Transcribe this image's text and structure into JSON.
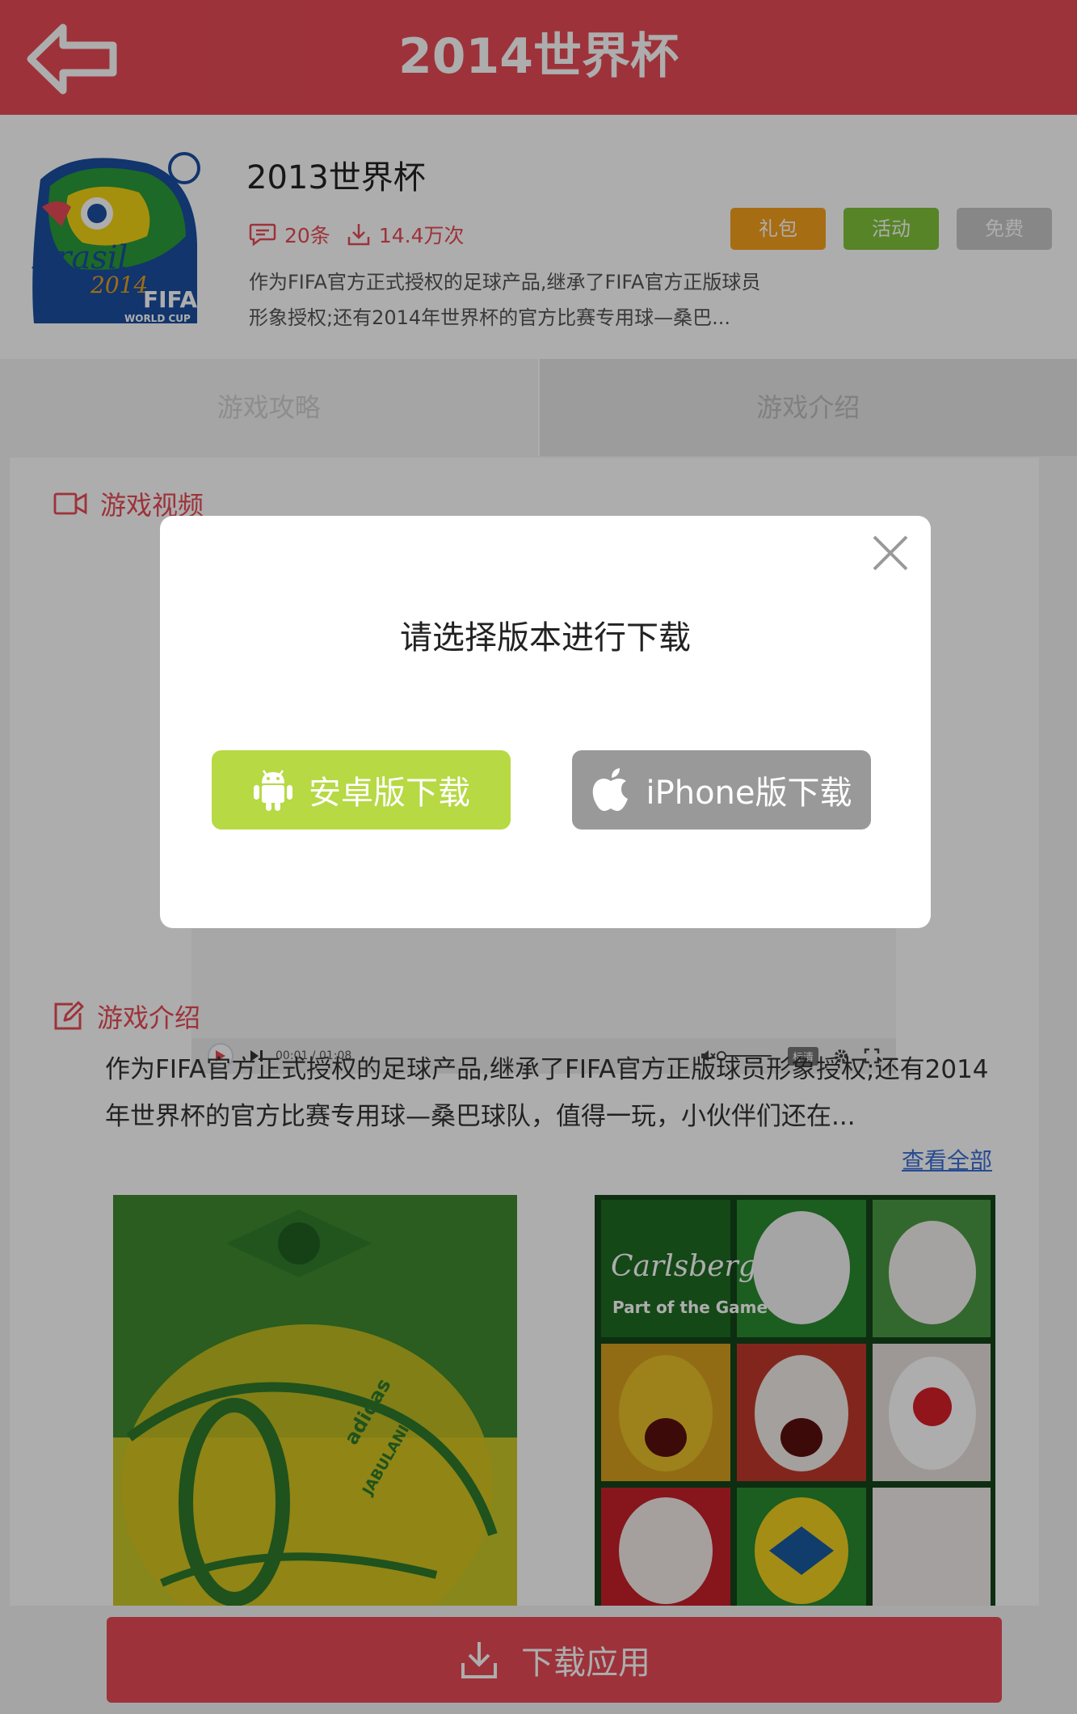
{
  "header": {
    "title": "2014世界杯"
  },
  "app": {
    "name": "2013世界杯",
    "comments": "20条",
    "downloads": "14.4万次",
    "description": "作为FIFA官方正式授权的足球产品,继承了FIFA官方正版球员形象授权;还有2014年世界杯的官方比赛专用球—桑巴...",
    "icon_text": {
      "brand": "Brasil",
      "year": "2014",
      "org": "FIFA",
      "sub": "WORLD CUP"
    },
    "tags": {
      "gift": "礼包",
      "event": "活动",
      "free": "免费"
    }
  },
  "tabs": {
    "guide": "游戏攻略",
    "intro": "游戏介绍"
  },
  "video": {
    "heading": "游戏视频",
    "time": "00:01 / 01:08",
    "quality": "标清"
  },
  "intro": {
    "heading": "游戏介绍",
    "text": "作为FIFA官方正式授权的足球产品,继承了FIFA官方正版球员形象授权;还有2014年世界杯的官方比赛专用球—桑巴球队，值得一玩，小伙伴们还在...",
    "view_all": "查看全部"
  },
  "screenshots": {
    "first": {
      "brand": "adidas",
      "name": "JABULANI"
    },
    "second": {
      "brand": "Carlsberg",
      "slogan": "Part of the Game"
    }
  },
  "footer": {
    "download_label": "下载应用"
  },
  "modal": {
    "title": "请选择版本进行下载",
    "android_label": "安卓版下载",
    "iphone_label": "iPhone版下载"
  },
  "colors": {
    "header": "#e84b56",
    "android": "#b6d944",
    "iphone": "#999999",
    "gift_tag": "#f7a11d",
    "event_tag": "#7fc33a",
    "free_tag": "#c8c8c8"
  }
}
